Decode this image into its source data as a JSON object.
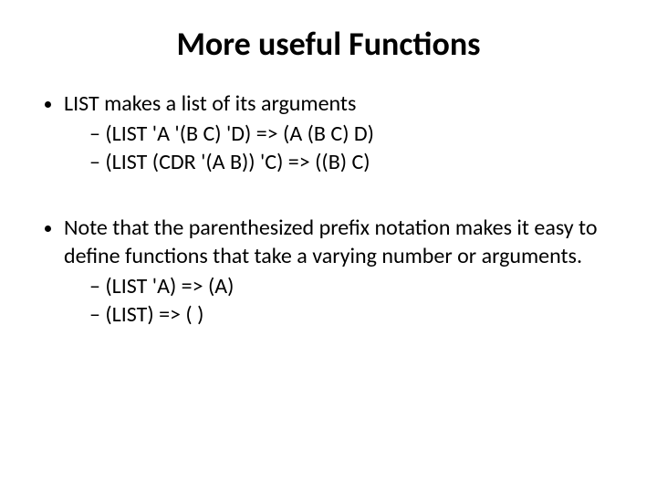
{
  "title": "More useful Functions",
  "bullets": [
    {
      "text": "LIST makes a list of its arguments",
      "sub": [
        "(LIST 'A '(B C) 'D) => (A (B C) D)",
        "(LIST (CDR '(A B)) 'C) => ((B) C)"
      ]
    },
    {
      "text": "Note that the parenthesized prefix notation makes it easy to define functions that take a varying number or arguments.",
      "sub": [
        "(LIST 'A) => (A)",
        "(LIST) => ( )"
      ]
    }
  ]
}
